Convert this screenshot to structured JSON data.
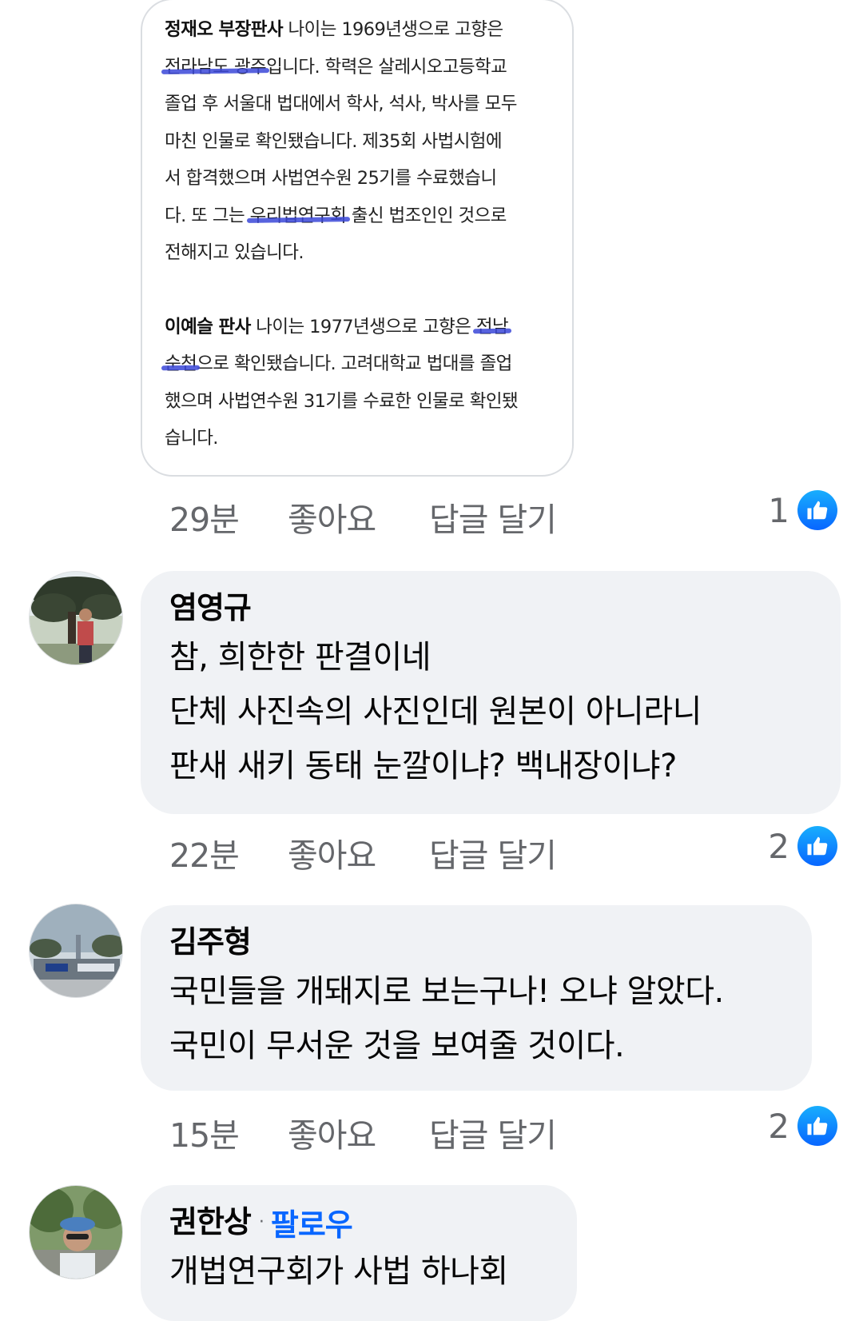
{
  "shared_image": {
    "paragraphs": [
      {
        "name": "정재오 부장판사",
        "text_a": " 나이는 1969년생으로 고향은",
        "highlight_1": "전라남도 광주",
        "text_b": "입니다. 학력은 살레시오고등학교",
        "text_c": "졸업 후 서울대 법대에서 학사, 석사, 박사를 모두",
        "text_d": "마친 인물로 확인됐습니다. 제35회 사법시험에",
        "text_e": "서 합격했으며 사법연수원 25기를 수료했습니",
        "text_f": "다. 또 그는 ",
        "highlight_2": "우리법연구회",
        "text_g": " 출신 법조인인 것으로",
        "text_h": "전해지고 있습니다."
      },
      {
        "name": "이예슬 판사",
        "text_a": " 나이는 1977년생으로 고향은 ",
        "highlight_1": "전남",
        "highlight_2": "순천",
        "text_b": "으로 확인됐습니다. 고려대학교 법대를 졸업",
        "text_c": "했으며 사법연수원 31기를 수료한 인물로 확인됐",
        "text_d": "습니다."
      }
    ]
  },
  "actions": {
    "like_label": "좋아요",
    "reply_label": "답글 달기"
  },
  "top_post": {
    "time": "29분",
    "like_count": "1"
  },
  "comments": [
    {
      "author": "염영규",
      "lines": [
        "참, 희한한 판결이네",
        "단체 사진속의 사진인데 원본이 아니라니",
        "판새 새키 동태 눈깔이냐? 백내장이냐?"
      ],
      "time": "22분",
      "like_count": "2"
    },
    {
      "author": "김주형",
      "lines": [
        "국민들을 개돼지로 보는구나! 오냐 알았다.",
        "국민이 무서운 것을 보여줄 것이다."
      ],
      "time": "15분",
      "like_count": "2"
    },
    {
      "author": "권한상",
      "separator": "·",
      "follow_label": "팔로우",
      "lines": [
        "개법연구회가 사법 하나회"
      ]
    }
  ],
  "colors": {
    "bubble_bg": "#f0f2f5",
    "meta_text": "#65676b",
    "link_blue": "#0866ff",
    "highlight": "#3b48d8"
  },
  "icons": {
    "reaction": "thumbs-up-icon"
  }
}
